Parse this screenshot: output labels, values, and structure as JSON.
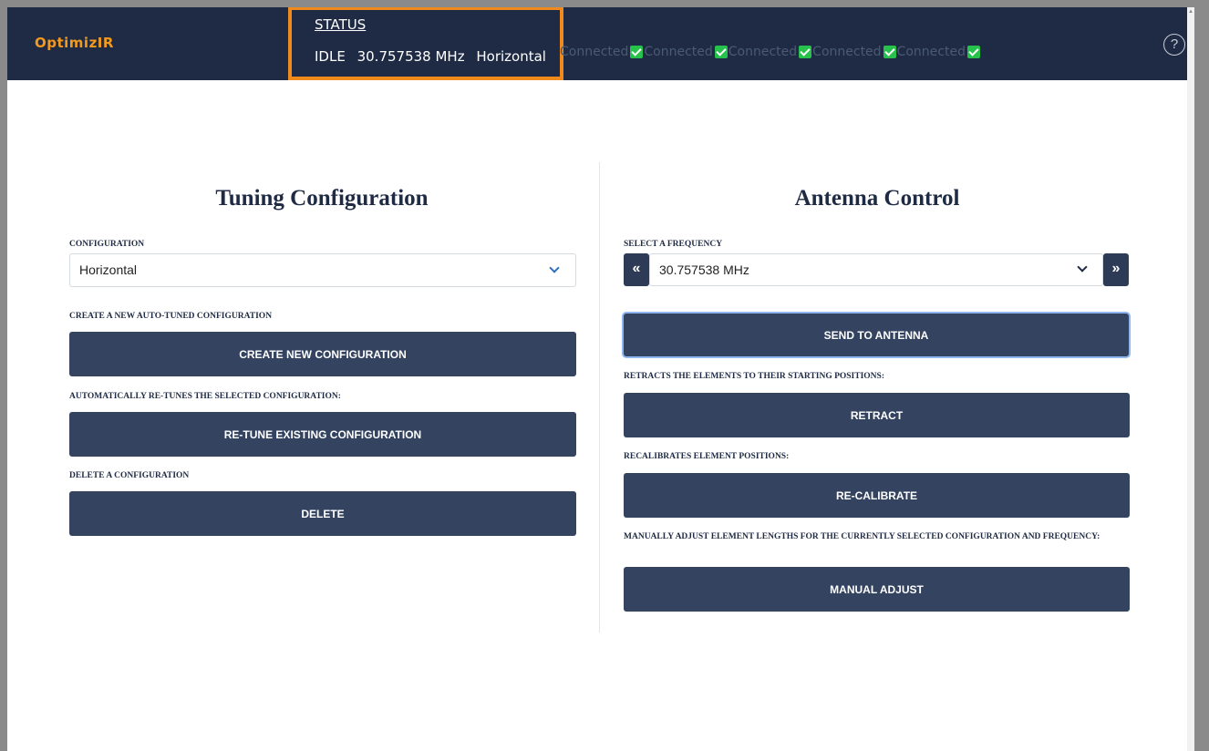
{
  "header": {
    "logo": "OptimizIR",
    "status_title": "STATUS",
    "status": {
      "state": "IDLE",
      "frequency": "30.757538 MHz",
      "configuration": "Horizontal"
    },
    "connections": [
      {
        "label": "Connected"
      },
      {
        "label": "Connected"
      },
      {
        "label": "Connected"
      },
      {
        "label": "Connected"
      },
      {
        "label": "Connected"
      }
    ],
    "help_symbol": "?"
  },
  "tuning": {
    "title": "Tuning Configuration",
    "configuration_label": "CONFIGURATION",
    "configuration_value": "Horizontal",
    "create_label": "CREATE A NEW AUTO-TUNED CONFIGURATION",
    "create_button": "CREATE NEW CONFIGURATION",
    "retune_label": "AUTOMATICALLY RE-TUNES THE SELECTED CONFIGURATION:",
    "retune_button": "RE-TUNE EXISTING CONFIGURATION",
    "delete_label": "DELETE A CONFIGURATION",
    "delete_button": "DELETE"
  },
  "antenna": {
    "title": "Antenna Control",
    "frequency_label": "SELECT A FREQUENCY",
    "frequency_value": "30.757538 MHz",
    "prev_symbol": "«",
    "next_symbol": "»",
    "send_button": "SEND TO ANTENNA",
    "retract_label": "RETRACTS THE ELEMENTS TO THEIR STARTING POSITIONS:",
    "retract_button": "RETRACT",
    "recalibrate_label": "RECALIBRATES ELEMENT POSITIONS:",
    "recalibrate_button": "RE-CALIBRATE",
    "manual_label": "MANUALLY ADJUST ELEMENT LENGTHS FOR THE CURRENTLY SELECTED CONFIGURATION AND FREQUENCY:",
    "manual_button": "MANUAL ADJUST"
  },
  "colors": {
    "header_bg": "#1f2b44",
    "logo": "#f39a1e",
    "status_highlight": "#f08a1c",
    "button_bg": "#334360",
    "check": "#27c24c",
    "chevron": "#2f6fc4"
  },
  "icons": {
    "help": "question-circle-icon",
    "check": "checkbox-checked-icon",
    "dropdown": "chevron-down-icon",
    "prev": "double-chevron-left-icon",
    "next": "double-chevron-right-icon"
  }
}
